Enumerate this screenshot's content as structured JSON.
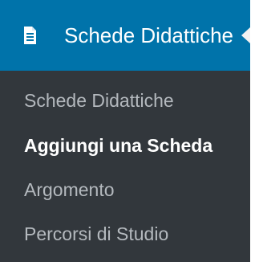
{
  "menu": {
    "header": {
      "label": "Schede Didattiche",
      "icon": "document-icon"
    },
    "items": [
      {
        "label": "Schede Didattiche",
        "current": false
      },
      {
        "label": "Aggiungi una Scheda",
        "current": true
      },
      {
        "label": "Argomento",
        "current": false
      },
      {
        "label": "Percorsi di Studio",
        "current": false
      }
    ]
  },
  "colors": {
    "header_bg": "#0073aa",
    "submenu_bg": "#32373c",
    "text_default": "#b4b9be",
    "text_active": "#ffffff"
  }
}
